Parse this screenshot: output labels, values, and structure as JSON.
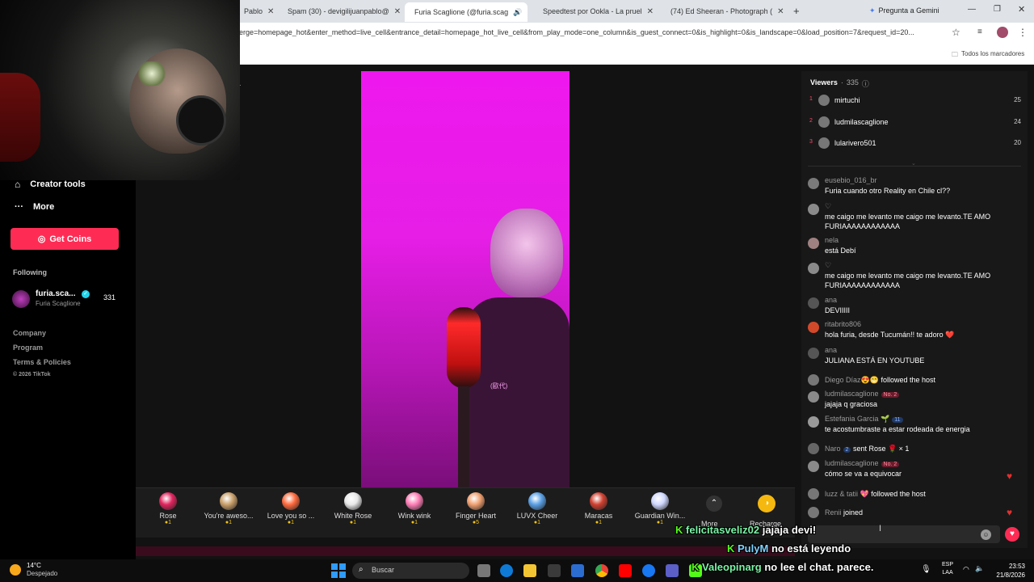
{
  "browser": {
    "tabs": [
      {
        "label": "Pablo",
        "color": "#e8453c"
      },
      {
        "label": "Spam (30) - devigilijuanpablo@",
        "color": "#d93025"
      },
      {
        "label": "Furia Scaglione (@furia.scag",
        "color": "#111111"
      },
      {
        "label": "Speedtest por Ookla - La pruel",
        "color": "#141526"
      },
      {
        "label": "(74) Ed Sheeran - Photograph (",
        "color": "#ff0000"
      }
    ],
    "gemini_label": "Pregunta a Gemini",
    "url": "erge=homepage_hot&enter_method=live_cell&entrance_detail=homepage_hot_live_cell&from_play_mode=one_column&is_guest_connect=0&is_highlight=0&is_landscape=0&load_position=7&request_id=20...",
    "bookmarks_label": "Todos los marcadores"
  },
  "sidebar": {
    "creator_tools": "Creator tools",
    "more": "More",
    "get_coins": "Get Coins",
    "following_heading": "Following",
    "following": [
      {
        "name": "furia.sca...",
        "sub": "Furia Scaglione",
        "count": "331"
      }
    ],
    "footer": [
      "Company",
      "Program",
      "Terms & Policies",
      "© 2026 TikTok"
    ]
  },
  "video": {
    "shirt_text": "(歐代)"
  },
  "gifts": [
    {
      "name": "Rose",
      "price": "1",
      "color": "#e0245e"
    },
    {
      "name": "You're aweso...",
      "price": "1",
      "color": "#c9a06a"
    },
    {
      "name": "Love you so ...",
      "price": "1",
      "color": "#ff6a3d"
    },
    {
      "name": "White Rose",
      "price": "1",
      "color": "#e8e8e8"
    },
    {
      "name": "Wink wink",
      "price": "1",
      "color": "#ff7eb6"
    },
    {
      "name": "Finger Heart",
      "price": "5",
      "color": "#f0a070"
    },
    {
      "name": "LUVX Cheer",
      "price": "1",
      "color": "#5aa0e6"
    },
    {
      "name": "Maracas",
      "price": "1",
      "color": "#d04030"
    },
    {
      "name": "Guardian Win...",
      "price": "1",
      "color": "#cfd8ff"
    }
  ],
  "gift_more": "More",
  "recharge": "Recharge",
  "viewers": {
    "title": "Viewers",
    "count": "335",
    "top": [
      {
        "rank": "1",
        "name": "mirtuchi",
        "score": "25"
      },
      {
        "rank": "2",
        "name": "ludmilascaglione",
        "score": "24"
      },
      {
        "rank": "3",
        "name": "lularivero501",
        "score": "20"
      }
    ]
  },
  "chat": [
    {
      "name": "eusebio_016_br",
      "msg": "Furia cuando otro Reality en Chile cl??",
      "av": "#7a7a7a"
    },
    {
      "name": "♡",
      "msg": "me caigo me levanto me caigo me levanto.TE AMO FURIAAAAAAAAAAAA",
      "av": "#8a8a8a"
    },
    {
      "name": "nela",
      "msg": "está Debí",
      "av": "#a08080"
    },
    {
      "name": "♡",
      "msg": "me caigo me levanto me caigo me levanto.TE AMO FURIAAAAAAAAAAAA",
      "av": "#8a8a8a"
    },
    {
      "name": "ana",
      "msg": "DEVIIIII",
      "av": "#555555"
    },
    {
      "name": "ritabrito806",
      "msg": "hola furia, desde Tucumán!! te adoro ❤️",
      "av": "#d2492a"
    },
    {
      "name": "ana",
      "msg": "JULIANA ESTÁ EN YOUTUBE",
      "av": "#555555"
    },
    {
      "name": "Diego Díaz😍😁",
      "msg": "followed the host",
      "av": "#777777"
    },
    {
      "name": "ludmilascaglione",
      "badge": "No. 2",
      "msg": "jajaja q graciosa",
      "av": "#8a8a8a"
    },
    {
      "name": "Estefania Garcia 🌱",
      "badge": "11",
      "msg": "te acostumbraste a estar rodeada de energia",
      "av": "#999999"
    },
    {
      "name": "Naro",
      "badge": "2",
      "msg": "sent Rose 🌹 × 1",
      "av": "#666666"
    },
    {
      "name": "ludmilascaglione",
      "badge": "No. 2",
      "msg": "cómo se va a equivocar",
      "av": "#8a8a8a"
    },
    {
      "name": "luzz & tatii 💖",
      "msg": "followed the host",
      "av": "#777777"
    },
    {
      "name": "Renii",
      "msg": "joined",
      "av": "#777777"
    }
  ],
  "overlay_chat": [
    {
      "user": "felicitasveliz02",
      "msg": "jajaja devi!",
      "color": "#7bf3a6"
    },
    {
      "user": "PulyM",
      "msg": "no está leyendo",
      "color": "#7fd3ff"
    },
    {
      "user": "Valeopinarg",
      "msg": "no lee el chat. parece.",
      "color": "#7bf3a6"
    }
  ],
  "taskbar": {
    "weather_temp": "14°C",
    "weather_desc": "Despejado",
    "search_placeholder": "Buscar",
    "lang_top": "ESP",
    "lang_bottom": "LAA",
    "time": "23:53",
    "date": "21/8/2026"
  }
}
